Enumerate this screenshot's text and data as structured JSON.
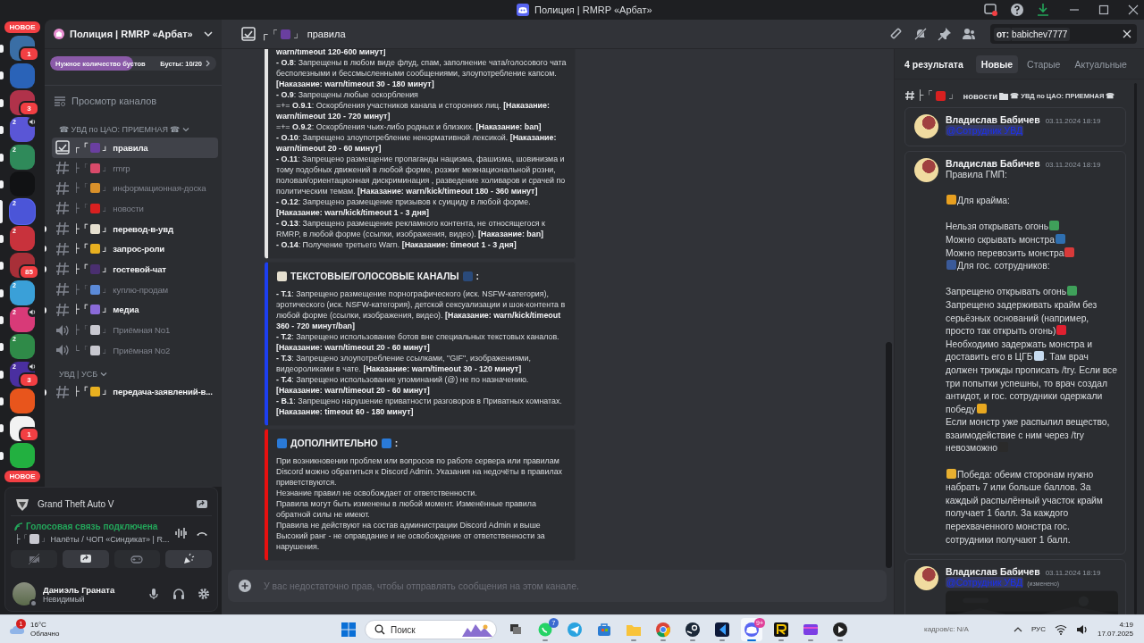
{
  "titlebar": {
    "title": "Полиция | RMRP «Арбат»"
  },
  "servers": [
    {
      "kind": "new",
      "label": "НОВОЕ"
    },
    {
      "kind": "server",
      "color": "#3a6ea5",
      "badge": "1",
      "unread": true,
      "selected": false
    },
    {
      "kind": "server",
      "color": "#2a63b8",
      "unread": true,
      "selected": false
    },
    {
      "kind": "server",
      "color": "#b0324a",
      "badge": "3",
      "unread": true,
      "selected": false
    },
    {
      "kind": "server",
      "color": "#5a56d6",
      "count": "2",
      "voice": true,
      "unread": true,
      "selected": false
    },
    {
      "kind": "server",
      "color": "#2f8a5a",
      "count": "2",
      "unread": true,
      "selected": false
    },
    {
      "kind": "server",
      "color": "#111214",
      "unread": true,
      "selected": false
    },
    {
      "kind": "server",
      "color": "#4b55d8",
      "count": "2",
      "unread": false,
      "selected": true
    },
    {
      "kind": "server",
      "color": "#c8323c",
      "count": "2",
      "unread": true,
      "selected": false
    },
    {
      "kind": "server",
      "color": "#a82f38",
      "badge": "85",
      "unread": true,
      "selected": false
    },
    {
      "kind": "server",
      "color": "#3aa0d8",
      "count": "2",
      "unread": true,
      "selected": false
    },
    {
      "kind": "server",
      "color": "#d83a78",
      "count": "2",
      "voice": true,
      "unread": true,
      "selected": false
    },
    {
      "kind": "server",
      "color": "#2f8a48",
      "count": "2",
      "unread": true,
      "selected": false
    },
    {
      "kind": "server",
      "color": "#4a2fa0",
      "count": "2",
      "voice": true,
      "badge": "3",
      "unread": true,
      "selected": false
    },
    {
      "kind": "server",
      "color": "#e8551c",
      "unread": true,
      "selected": false
    },
    {
      "kind": "server",
      "color": "#f2f2f2",
      "badge": "1",
      "unread": true,
      "selected": false
    },
    {
      "kind": "server",
      "color": "#22b040",
      "unread": true,
      "selected": false
    },
    {
      "kind": "new",
      "label": "НОВОЕ"
    }
  ],
  "server_header": {
    "name": "Полиция | RMRP «Арбат»"
  },
  "boost": {
    "label": "Нужное количество бустов",
    "count": "Бусты: 10/20",
    "level": 0.5
  },
  "browse": {
    "label": "Просмотр каналов"
  },
  "categories": [
    {
      "name": "☎ УВД по ЦАО: ПРИЕМНАЯ ☎",
      "channels": [
        {
          "kind": "rules",
          "lead": "┌「",
          "color": "#6a3fa0",
          "close": "」",
          "name": "правила",
          "selected": true,
          "unread": false
        },
        {
          "kind": "text",
          "lead": "├「",
          "color": "#d84a6a",
          "close": "」",
          "name": "rmrp",
          "selected": false,
          "unread": false
        },
        {
          "kind": "text",
          "lead": "├「",
          "color": "#d8902a",
          "close": "」",
          "name": "информационная-доска",
          "selected": false,
          "unread": false
        },
        {
          "kind": "text",
          "lead": "├「",
          "color": "#d82020",
          "close": "」",
          "name": "новости",
          "selected": false,
          "unread": false
        },
        {
          "kind": "text",
          "lead": "├「",
          "color": "#e6e0d0",
          "close": "」",
          "name": "перевод-в-увд",
          "selected": false,
          "unread": true
        },
        {
          "kind": "text",
          "lead": "├「",
          "color": "#e8b020",
          "close": "」",
          "name": "запрос-роли",
          "selected": false,
          "unread": true
        },
        {
          "kind": "text",
          "lead": "├「",
          "color": "#4a2f70",
          "close": "」",
          "name": "гостевой-чат",
          "selected": false,
          "unread": true
        },
        {
          "kind": "text",
          "lead": "├「",
          "color": "#5b8ad8",
          "close": "」",
          "name": "куплю-продам",
          "selected": false,
          "unread": false
        },
        {
          "kind": "text",
          "lead": "├「",
          "color": "#8a6ad8",
          "close": "」",
          "name": "медиа",
          "selected": false,
          "unread": true
        },
        {
          "kind": "voice",
          "lead": "├「",
          "color": "#c8c8d0",
          "close": "」",
          "name": "Приёмная No1",
          "selected": false,
          "unread": false
        },
        {
          "kind": "voice",
          "lead": "└「",
          "color": "#c8c8d0",
          "close": "」",
          "name": "Приёмная No2",
          "selected": false,
          "unread": false
        }
      ]
    },
    {
      "name": "УВД | УСБ",
      "channels": [
        {
          "kind": "text",
          "lead": "├「",
          "color": "#e8b020",
          "close": "」",
          "name": "передача-заявлений-в...",
          "selected": false,
          "unread": true
        }
      ]
    }
  ],
  "activity": {
    "game": "Grand Theft Auto V"
  },
  "voice": {
    "status": "Голосовая связь подключена",
    "lead": "├「",
    "color": "#c8c8d0",
    "close": "」",
    "channel": "Налёты / ЧОП «Синдикат» | R..."
  },
  "user": {
    "name": "Даниэль Граната",
    "status": "Невидимый"
  },
  "channel_header": {
    "lead": "┌「",
    "color": "#6a3fa0",
    "close": "」",
    "name": "правила"
  },
  "search": {
    "filter": "от:",
    "value": "babichev7777"
  },
  "embeds": [
    {
      "color": "#e6e6e6",
      "lines": [
        "**warn/timeout 120-600 минут]**",
        "**- О.8**: Запрещены в любом виде флуд, спам, заполнение чата/голосового чата бесполезными и бессмысленными сообщениями, злоупотребление капсом. **[Наказание: warn/timeout 30 - 180 минут]**",
        "**- О.9**: Запрещены любые оскорбления",
        "=+= **О.9.1**: Оскорбления участников канала и сторонних лиц. **[Наказание: warn/timeout 120 - 720 минут]**",
        "=+= **О.9.2**: Оскорбления чьих-либо родных и близких. **[Наказание: ban]**",
        "**- О.10**: Запрещено злоупотребление ненормативной лексикой. **[Наказание: warn/timeout 20 - 60 минут]**",
        "**- О.11**: Запрещено размещение пропаганды нацизма, фашизма, шовинизма и тому подобных движений в любой форме, розжиг межнациональной розни, половая/ориентационная дискриминация , разведение холиваров и срачей по политическим темам. **[Наказание: warn/kick/timeout 180 - 360 минут]**",
        "**- О.12**: Запрещено размещение призывов к суициду в любой форме. **[Наказание: warn/kick/timeout 1 - 3 дня]**",
        "**- О.13**: Запрещено размещение рекламного контента, не относящегося к RMRP, в любой форме (ссылки, изображения, видео). **[Наказание: ban]**",
        "**- О.14**: Получение третьего Warn. **[Наказание: timeout 1 - 3 дня]**"
      ]
    },
    {
      "color": "#1d3ff0",
      "title": [
        {
          "kind": "emoji",
          "color": "#e6e0d0"
        },
        {
          "kind": "text",
          "text": "ТЕКСТОВЫЕ/ГОЛОСОВЫЕ КАНАЛЫ"
        },
        {
          "kind": "emoji",
          "color": "#2a4a7a"
        },
        {
          "kind": "text",
          "text": ":"
        }
      ],
      "lines": [
        "**- Т.1**: Запрещено размещение порнографического (иск. NSFW-категория), эротического (иск. NSFW-категория), детской сексуализации и шок-контента в любой форме (ссылки, изображения, видео). **[Наказание: warn/kick/timeout 360 - 720 минут/ban]**",
        "**- Т.2**: Запрещено использование ботов вне специальных текстовых каналов. **[Наказание: warn/timeout 20 - 60 минут]**",
        "**- Т.3**: Запрещено злоупотребление ссылками, \"GIF\", изображениями, видеороликами в чате. **[Наказание: warn/timeout 30 - 120 минут]**",
        "**- Т.4**: Запрещено использование упоминаний (@) не по назначению. **[Наказание: warn/timeout 20 - 60 минут]**",
        "**- В.1**: Запрещено нарушение приватности разговоров в Приватных комнатах. **[Наказание: timeout 60 - 180 минут]**"
      ]
    },
    {
      "color": "#e81010",
      "title": [
        {
          "kind": "emoji",
          "color": "#2a7ad8"
        },
        {
          "kind": "text",
          "text": "ДОПОЛНИТЕЛЬНО"
        },
        {
          "kind": "emoji",
          "color": "#2a7ad8"
        },
        {
          "kind": "text",
          "text": ":"
        }
      ],
      "lines": [
        "При возникновении проблем или вопросов по работе сервера или правилам Discord можно обратиться к Discord Admin. Указания на недочёты в правилах приветствуются.",
        "Незнание правил не освобождает от ответственности.",
        "Правила могут быть изменены в любой момент. Изменённые правила обратной силы не имеют.",
        "Правила не действуют на состав администрации Discord Admin и выше",
        "Высокий ранг - не оправдание и не освобождение от ответственности за нарушения."
      ]
    }
  ],
  "composer": {
    "placeholder": "У вас недостаточно прав, чтобы отправлять сообщения на этом канале."
  },
  "results": {
    "count": "4 результата",
    "tabs": [
      {
        "label": "Новые",
        "selected": true
      },
      {
        "label": "Старые",
        "selected": false
      },
      {
        "label": "Актуальные",
        "selected": false
      }
    ],
    "channel": {
      "lead": "├「",
      "color": "#d82020",
      "close": "」",
      "name": "новости",
      "category": "☎ УВД по ЦАО: ПРИЕМНАЯ ☎"
    },
    "messages": [
      {
        "author": "Владислав Бабичев",
        "time": "03.11.2024 18:19",
        "mention": "@Сотрудник УВД"
      },
      {
        "author": "Владислав Бабичев",
        "time": "03.11.2024 18:19",
        "lines": [
          {
            "gap_before": false,
            "parts": [
              {
                "kind": "text",
                "text": "Правила ГМП:"
              }
            ]
          },
          {
            "gap_before": true,
            "parts": [
              {
                "kind": "emoji",
                "color": "#e8a020"
              },
              {
                "kind": "text",
                "text": "Для крайма:"
              }
            ]
          },
          {
            "gap_before": true,
            "parts": [
              {
                "kind": "text",
                "text": "Нельзя открывать огонь"
              },
              {
                "kind": "emoji",
                "color": "#3fa05a"
              }
            ]
          },
          {
            "gap_before": false,
            "parts": [
              {
                "kind": "text",
                "text": "Можно скрывать монстра"
              },
              {
                "kind": "emoji",
                "color": "#2f6fb0"
              }
            ]
          },
          {
            "gap_before": false,
            "parts": [
              {
                "kind": "text",
                "text": "Можно перевозить монстра"
              },
              {
                "kind": "emoji",
                "color": "#d83a3a"
              }
            ]
          },
          {
            "gap_before": false,
            "parts": [
              {
                "kind": "emoji",
                "color": "#3a5a9a"
              },
              {
                "kind": "text",
                "text": "Для гос. сотрудников:"
              }
            ]
          },
          {
            "gap_before": true,
            "parts": [
              {
                "kind": "text",
                "text": "Запрещено открывать огонь"
              },
              {
                "kind": "emoji",
                "color": "#3fa05a"
              }
            ]
          },
          {
            "gap_before": false,
            "parts": [
              {
                "kind": "text",
                "text": "Запрещено задерживать крайм без серьёзных оснований (например, просто так открыть огонь)"
              },
              {
                "kind": "emoji",
                "color": "#e02030"
              }
            ]
          },
          {
            "gap_before": false,
            "parts": [
              {
                "kind": "text",
                "text": "Необходимо задержать монстра и доставить его в ЦГБ"
              },
              {
                "kind": "emoji",
                "color": "#c8dcf0"
              },
              {
                "kind": "text",
                "text": ". Там врач должен трижды прописать /try. Если все три попытки успешны, то врач создал антидот, и гос. сотрудники одержали победу"
              },
              {
                "kind": "emoji",
                "color": "#e8a820"
              }
            ]
          },
          {
            "gap_before": false,
            "parts": [
              {
                "kind": "text",
                "text": "Если монстр уже распылил вещество, взаимодействие с ним через /try невозможно"
              },
              {
                "kind": "emoji",
                "color": "#2a2a2a"
              }
            ]
          },
          {
            "gap_before": true,
            "parts": [
              {
                "kind": "emoji",
                "color": "#e8b030"
              },
              {
                "kind": "text",
                "text": "Победа: обеим сторонам нужно набрать 7 или больше баллов. За каждый распылённый участок крайм получает 1 балл. За каждого перехваченного монстра гос. сотрудники получают 1 балл."
              }
            ]
          }
        ]
      },
      {
        "author": "Владислав Бабичев",
        "time": "03.11.2024 18:19",
        "mention": "@Сотрудник УВД",
        "edited": "(изменено)"
      }
    ]
  },
  "taskbar": {
    "weather": {
      "temp": "16°C",
      "desc": "Облачно",
      "badge": "1"
    },
    "search": {
      "placeholder": "Поиск"
    },
    "apps": [
      {
        "kind": "taskview",
        "running": false,
        "selected": false
      },
      {
        "kind": "chat",
        "badge": "7",
        "running": true,
        "selected": false
      },
      {
        "kind": "plane",
        "running": false,
        "selected": false
      },
      {
        "kind": "store",
        "running": false,
        "selected": false
      },
      {
        "kind": "folder",
        "running": true,
        "selected": false
      },
      {
        "kind": "browser",
        "running": true,
        "selected": false
      },
      {
        "kind": "steam",
        "running": true,
        "selected": false
      },
      {
        "kind": "code",
        "running": true,
        "selected": false
      },
      {
        "kind": "discord",
        "badge": "9+",
        "running": true,
        "selected": true
      },
      {
        "kind": "rapp",
        "running": true,
        "selected": false
      },
      {
        "kind": "video",
        "running": true,
        "selected": false
      },
      {
        "kind": "play",
        "running": true,
        "selected": false
      }
    ],
    "fps": "кадров/с: N/A",
    "lang": "РУС",
    "time": "4:19",
    "date": "17.07.2025"
  }
}
